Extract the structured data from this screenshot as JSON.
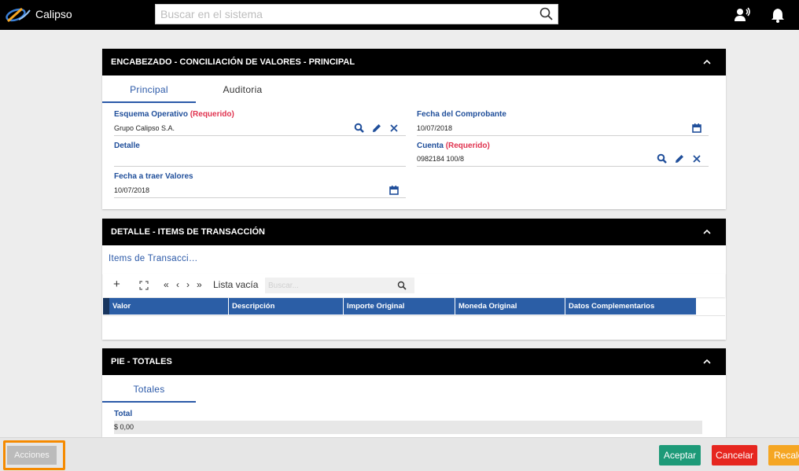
{
  "app": {
    "brand": "Calipso"
  },
  "topbar": {
    "search_placeholder": "Buscar en el sistema",
    "icons": [
      "search-icon",
      "voice-user-icon",
      "bell-icon"
    ]
  },
  "encabezado": {
    "title": "ENCABEZADO - CONCILIACIÓN DE VALORES - PRINCIPAL",
    "tabs": [
      "Principal",
      "Auditoria"
    ],
    "fields": {
      "esquema_label": "Esquema Operativo",
      "esquema_required": "(Requerido)",
      "esquema_value": "Grupo Calipso S.A.",
      "detalle_label": "Detalle",
      "detalle_value": "",
      "fecha_traer_label": "Fecha a traer Valores",
      "fecha_traer_value": "10/07/2018",
      "fecha_comp_label": "Fecha del Comprobante",
      "fecha_comp_value": "10/07/2018",
      "cuenta_label": "Cuenta",
      "cuenta_required": "(Requerido)",
      "cuenta_value": "0982184 100/8"
    }
  },
  "detalle": {
    "title": "DETALLE - ITEMS DE TRANSACCIÓN",
    "tab": "Items de Transacci…",
    "toolbar": {
      "add": "+",
      "expand": "⛶",
      "first": "«",
      "prev": "‹",
      "next": "›",
      "last": "»",
      "status": "Lista vacía",
      "search_placeholder": "Buscar..."
    },
    "columns": [
      "Valor",
      "Descripción",
      "Importe Original",
      "Moneda Original",
      "Datos Complementarios"
    ]
  },
  "pie": {
    "title": "PIE - TOTALES",
    "tab": "Totales",
    "total_label": "Total",
    "total_value": "$ 0,00"
  },
  "bottombar": {
    "acciones": "Acciones",
    "aceptar": "Aceptar",
    "cancelar": "Cancelar",
    "recalcular": "Recalc"
  },
  "colors": {
    "accent": "#2b59a8",
    "required": "#e0334f",
    "aceptar": "#1d9a78",
    "cancelar": "#e6261f",
    "recalcular": "#f5a623",
    "highlight": "#f58a00"
  }
}
